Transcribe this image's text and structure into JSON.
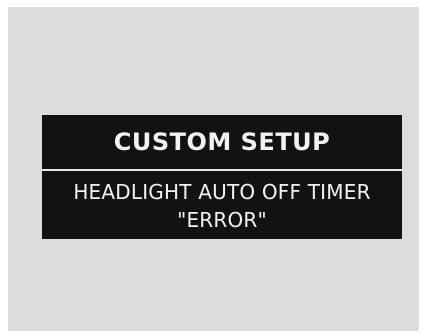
{
  "display": {
    "title": "CUSTOM SETUP",
    "message_line_1": "HEADLIGHT AUTO OFF TIMER",
    "message_line_2": "\"ERROR\""
  },
  "colors": {
    "outer_background": "#dcdcdc",
    "display_background": "#121212",
    "display_text": "#f2f2f2",
    "divider": "#e8e8e8"
  }
}
